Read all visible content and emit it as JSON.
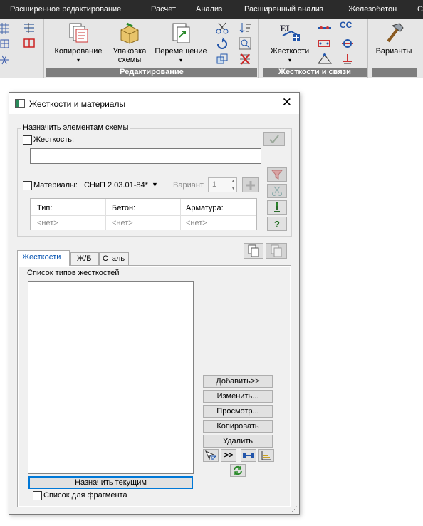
{
  "menubar": {
    "items": [
      "Расширенное редактирование",
      "Расчет",
      "Анализ",
      "Расширенный анализ",
      "Железобетон",
      "С"
    ]
  },
  "ribbon": {
    "edit_group": {
      "title": "Редактирование",
      "copy": "Копирование",
      "pack_line1": "Упаковка",
      "pack_line2": "схемы",
      "move": "Перемещение"
    },
    "stiff_group": {
      "title": "Жесткости и связи",
      "stiff": "Жесткости",
      "cc": "СС"
    },
    "variants": "Варианты"
  },
  "dialog": {
    "title": "Жесткости и материалы",
    "assign_group": "Назначить элементам схемы",
    "stiffness_label": "Жесткость:",
    "stiffness_value": "",
    "materials_label": "Материалы:",
    "norm": "СНиП 2.03.01-84*",
    "variant_label": "Вариант",
    "variant_value": "1",
    "table": {
      "headers": [
        "Тип:",
        "Бетон:",
        "Арматура:"
      ],
      "values": [
        "<нет>",
        "<нет>",
        "<нет>"
      ]
    },
    "tabs": [
      "Жесткости",
      "Ж/Б",
      "Сталь"
    ],
    "list_title": "Список типов жесткостей",
    "buttons": {
      "add": "Добавить>>",
      "edit": "Изменить...",
      "view": "Просмотр...",
      "copy": "Копировать",
      "delete": "Удалить",
      "forward": ">>"
    },
    "assign_current": "Назначить текущим",
    "fragment_list": "Список для фрагмента"
  }
}
